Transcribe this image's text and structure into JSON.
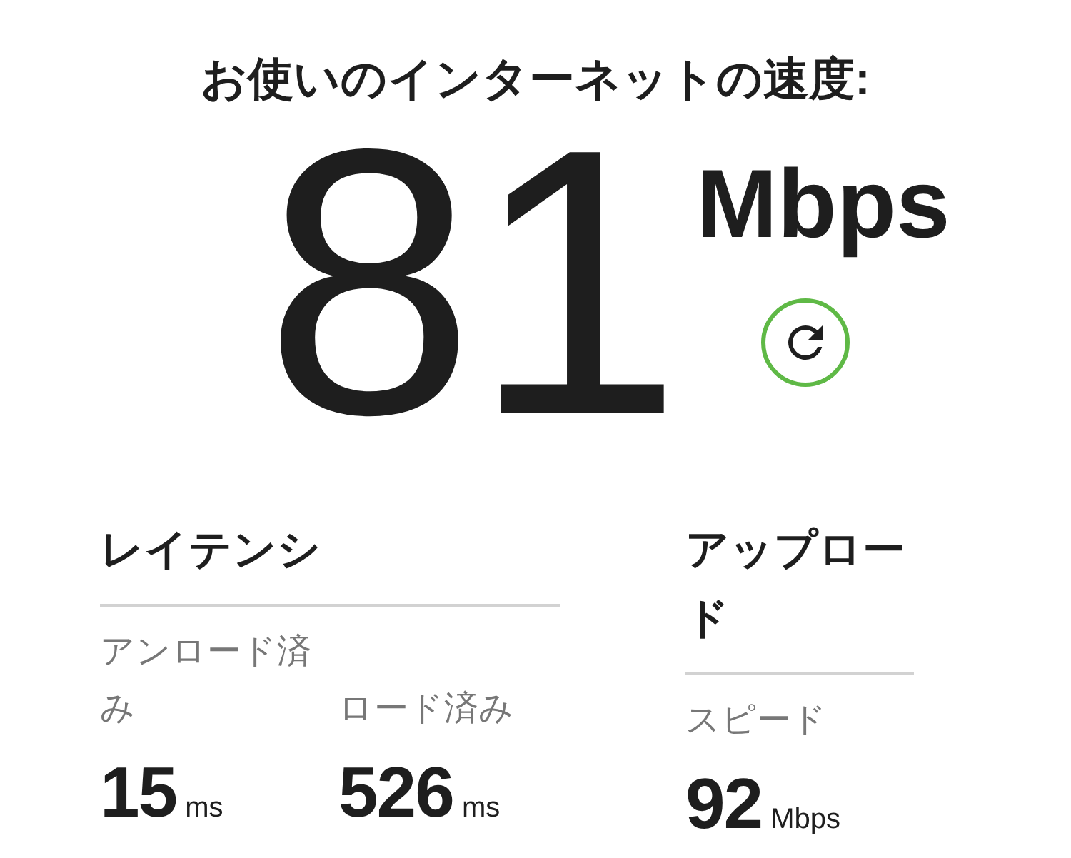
{
  "title": "お使いのインターネットの速度:",
  "speed": {
    "value": "81",
    "unit": "Mbps"
  },
  "latency": {
    "heading": "レイテンシ",
    "metrics": [
      {
        "label": "アンロード済み",
        "value": "15",
        "unit": "ms"
      },
      {
        "label": "ロード済み",
        "value": "526",
        "unit": "ms"
      }
    ]
  },
  "upload": {
    "heading": "アップロード",
    "metrics": [
      {
        "label": "スピード",
        "value": "92",
        "unit": "Mbps"
      }
    ]
  }
}
